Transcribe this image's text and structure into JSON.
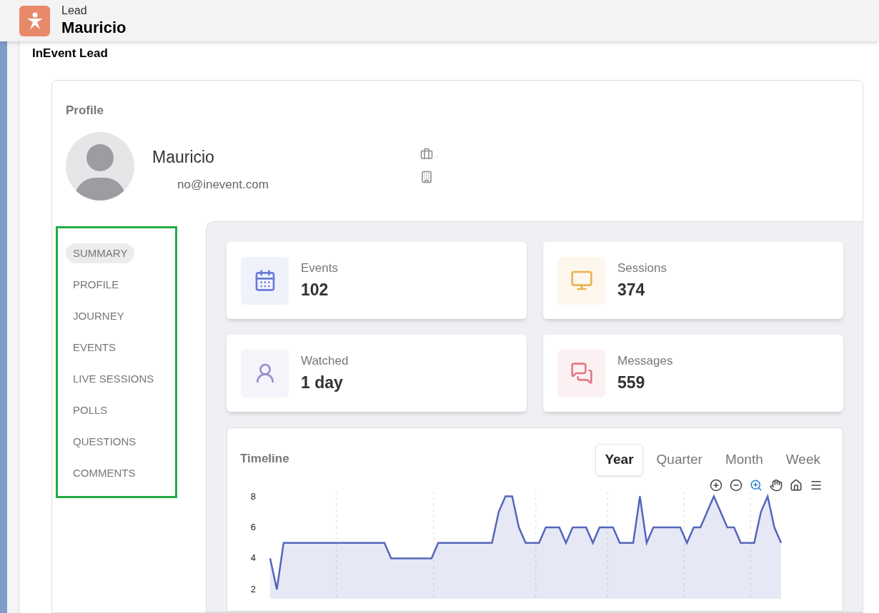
{
  "header": {
    "object_type": "Lead",
    "title": "Mauricio"
  },
  "section_title": "InEvent Lead",
  "profile": {
    "heading": "Profile",
    "name": "Mauricio",
    "email": "no@inevent.com",
    "job_value": "."
  },
  "nav": [
    {
      "label": "SUMMARY",
      "selected": true
    },
    {
      "label": "PROFILE",
      "selected": false
    },
    {
      "label": "JOURNEY",
      "selected": false
    },
    {
      "label": "EVENTS",
      "selected": false
    },
    {
      "label": "LIVE SESSIONS",
      "selected": false
    },
    {
      "label": "POLLS",
      "selected": false
    },
    {
      "label": "QUESTIONS",
      "selected": false
    },
    {
      "label": "COMMENTS",
      "selected": false
    }
  ],
  "stats": [
    {
      "label": "Events",
      "value": "102",
      "color": "#6b7bd8"
    },
    {
      "label": "Sessions",
      "value": "374",
      "color": "#e8b451"
    },
    {
      "label": "Watched",
      "value": "1 day",
      "color": "#9a8fd0"
    },
    {
      "label": "Messages",
      "value": "559",
      "color": "#e07a84"
    }
  ],
  "timeline": {
    "title": "Timeline",
    "ranges": [
      {
        "label": "Year",
        "selected": true
      },
      {
        "label": "Quarter",
        "selected": false
      },
      {
        "label": "Month",
        "selected": false
      },
      {
        "label": "Week",
        "selected": false
      }
    ],
    "chart_data": {
      "type": "area",
      "ylim": [
        1.4,
        8.3
      ],
      "yticks": [
        2,
        4,
        6,
        8
      ],
      "series": [
        {
          "color": "#5566bb",
          "values": [
            4,
            2,
            5,
            5,
            5,
            5,
            5,
            5,
            5,
            5,
            5,
            5,
            5,
            5,
            5,
            5,
            5,
            5,
            4,
            4,
            4,
            4,
            4,
            4,
            4,
            5,
            5,
            5,
            5,
            5,
            5,
            5,
            5,
            5,
            7,
            8,
            8,
            6,
            5,
            5,
            5,
            6,
            6,
            6,
            5,
            6,
            6,
            6,
            5,
            6,
            6,
            6,
            5,
            5,
            5,
            8,
            5,
            6,
            6,
            6,
            6,
            6,
            5,
            6,
            6,
            7,
            8,
            7,
            6,
            6,
            5,
            5,
            5,
            7,
            8,
            6,
            5
          ]
        }
      ]
    }
  }
}
